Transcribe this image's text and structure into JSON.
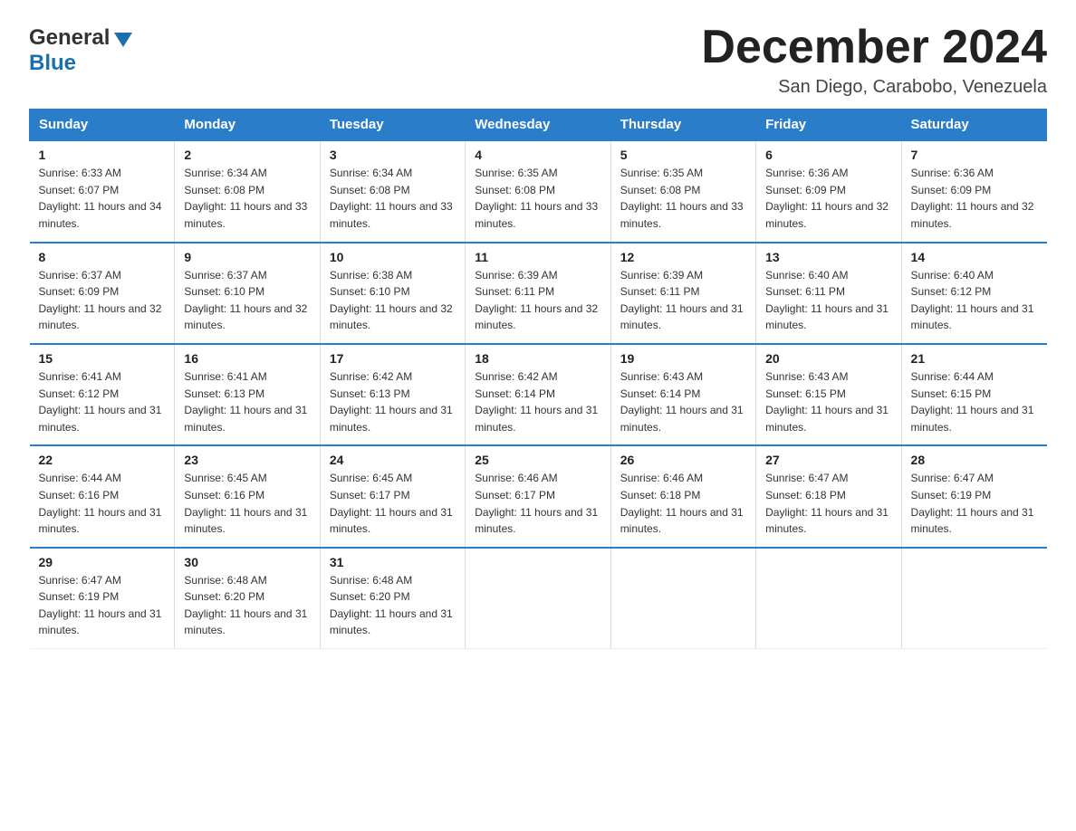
{
  "header": {
    "logo_general": "General",
    "logo_blue": "Blue",
    "month_title": "December 2024",
    "location": "San Diego, Carabobo, Venezuela"
  },
  "days_of_week": [
    "Sunday",
    "Monday",
    "Tuesday",
    "Wednesday",
    "Thursday",
    "Friday",
    "Saturday"
  ],
  "weeks": [
    [
      {
        "day": "1",
        "sunrise": "6:33 AM",
        "sunset": "6:07 PM",
        "daylight": "11 hours and 34 minutes."
      },
      {
        "day": "2",
        "sunrise": "6:34 AM",
        "sunset": "6:08 PM",
        "daylight": "11 hours and 33 minutes."
      },
      {
        "day": "3",
        "sunrise": "6:34 AM",
        "sunset": "6:08 PM",
        "daylight": "11 hours and 33 minutes."
      },
      {
        "day": "4",
        "sunrise": "6:35 AM",
        "sunset": "6:08 PM",
        "daylight": "11 hours and 33 minutes."
      },
      {
        "day": "5",
        "sunrise": "6:35 AM",
        "sunset": "6:08 PM",
        "daylight": "11 hours and 33 minutes."
      },
      {
        "day": "6",
        "sunrise": "6:36 AM",
        "sunset": "6:09 PM",
        "daylight": "11 hours and 32 minutes."
      },
      {
        "day": "7",
        "sunrise": "6:36 AM",
        "sunset": "6:09 PM",
        "daylight": "11 hours and 32 minutes."
      }
    ],
    [
      {
        "day": "8",
        "sunrise": "6:37 AM",
        "sunset": "6:09 PM",
        "daylight": "11 hours and 32 minutes."
      },
      {
        "day": "9",
        "sunrise": "6:37 AM",
        "sunset": "6:10 PM",
        "daylight": "11 hours and 32 minutes."
      },
      {
        "day": "10",
        "sunrise": "6:38 AM",
        "sunset": "6:10 PM",
        "daylight": "11 hours and 32 minutes."
      },
      {
        "day": "11",
        "sunrise": "6:39 AM",
        "sunset": "6:11 PM",
        "daylight": "11 hours and 32 minutes."
      },
      {
        "day": "12",
        "sunrise": "6:39 AM",
        "sunset": "6:11 PM",
        "daylight": "11 hours and 31 minutes."
      },
      {
        "day": "13",
        "sunrise": "6:40 AM",
        "sunset": "6:11 PM",
        "daylight": "11 hours and 31 minutes."
      },
      {
        "day": "14",
        "sunrise": "6:40 AM",
        "sunset": "6:12 PM",
        "daylight": "11 hours and 31 minutes."
      }
    ],
    [
      {
        "day": "15",
        "sunrise": "6:41 AM",
        "sunset": "6:12 PM",
        "daylight": "11 hours and 31 minutes."
      },
      {
        "day": "16",
        "sunrise": "6:41 AM",
        "sunset": "6:13 PM",
        "daylight": "11 hours and 31 minutes."
      },
      {
        "day": "17",
        "sunrise": "6:42 AM",
        "sunset": "6:13 PM",
        "daylight": "11 hours and 31 minutes."
      },
      {
        "day": "18",
        "sunrise": "6:42 AM",
        "sunset": "6:14 PM",
        "daylight": "11 hours and 31 minutes."
      },
      {
        "day": "19",
        "sunrise": "6:43 AM",
        "sunset": "6:14 PM",
        "daylight": "11 hours and 31 minutes."
      },
      {
        "day": "20",
        "sunrise": "6:43 AM",
        "sunset": "6:15 PM",
        "daylight": "11 hours and 31 minutes."
      },
      {
        "day": "21",
        "sunrise": "6:44 AM",
        "sunset": "6:15 PM",
        "daylight": "11 hours and 31 minutes."
      }
    ],
    [
      {
        "day": "22",
        "sunrise": "6:44 AM",
        "sunset": "6:16 PM",
        "daylight": "11 hours and 31 minutes."
      },
      {
        "day": "23",
        "sunrise": "6:45 AM",
        "sunset": "6:16 PM",
        "daylight": "11 hours and 31 minutes."
      },
      {
        "day": "24",
        "sunrise": "6:45 AM",
        "sunset": "6:17 PM",
        "daylight": "11 hours and 31 minutes."
      },
      {
        "day": "25",
        "sunrise": "6:46 AM",
        "sunset": "6:17 PM",
        "daylight": "11 hours and 31 minutes."
      },
      {
        "day": "26",
        "sunrise": "6:46 AM",
        "sunset": "6:18 PM",
        "daylight": "11 hours and 31 minutes."
      },
      {
        "day": "27",
        "sunrise": "6:47 AM",
        "sunset": "6:18 PM",
        "daylight": "11 hours and 31 minutes."
      },
      {
        "day": "28",
        "sunrise": "6:47 AM",
        "sunset": "6:19 PM",
        "daylight": "11 hours and 31 minutes."
      }
    ],
    [
      {
        "day": "29",
        "sunrise": "6:47 AM",
        "sunset": "6:19 PM",
        "daylight": "11 hours and 31 minutes."
      },
      {
        "day": "30",
        "sunrise": "6:48 AM",
        "sunset": "6:20 PM",
        "daylight": "11 hours and 31 minutes."
      },
      {
        "day": "31",
        "sunrise": "6:48 AM",
        "sunset": "6:20 PM",
        "daylight": "11 hours and 31 minutes."
      },
      null,
      null,
      null,
      null
    ]
  ],
  "labels": {
    "sunrise": "Sunrise:",
    "sunset": "Sunset:",
    "daylight": "Daylight:"
  },
  "colors": {
    "header_bg": "#2a7dc9",
    "header_border": "#2a7dc9"
  }
}
